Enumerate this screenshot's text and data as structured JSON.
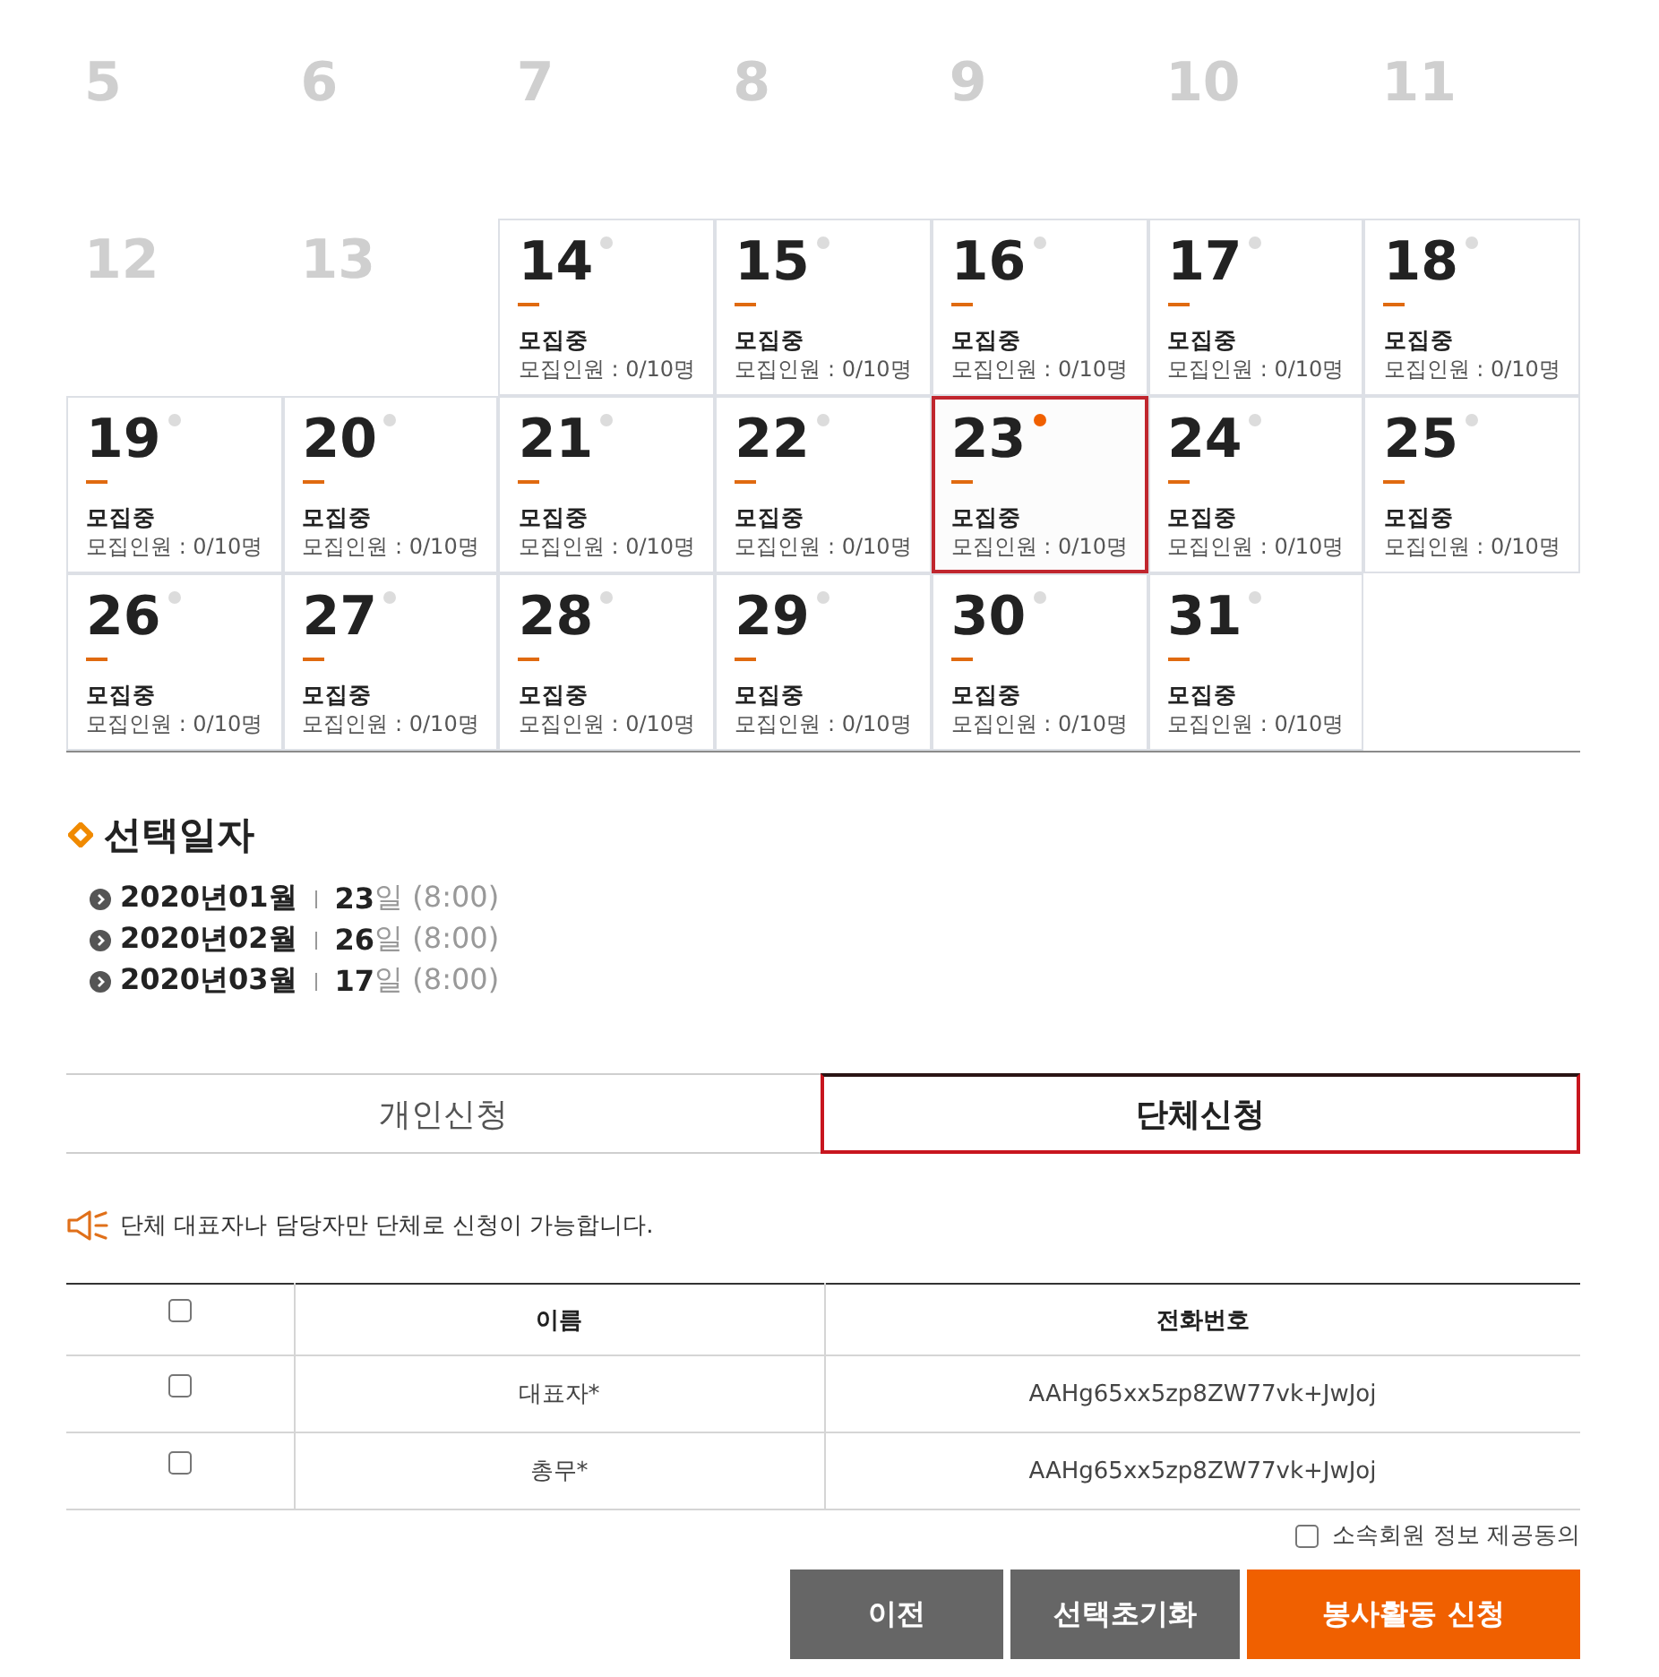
{
  "calendar": {
    "weeks": [
      [
        {
          "day": "5",
          "kind": "past"
        },
        {
          "day": "6",
          "kind": "past"
        },
        {
          "day": "7",
          "kind": "past"
        },
        {
          "day": "8",
          "kind": "past"
        },
        {
          "day": "9",
          "kind": "past"
        },
        {
          "day": "10",
          "kind": "past"
        },
        {
          "day": "11",
          "kind": "past"
        }
      ],
      [
        {
          "day": "12",
          "kind": "past"
        },
        {
          "day": "13",
          "kind": "past"
        },
        {
          "day": "14",
          "kind": "open",
          "status": "모집중",
          "capacity": "모집인원 : 0/10명",
          "selected": false
        },
        {
          "day": "15",
          "kind": "open",
          "status": "모집중",
          "capacity": "모집인원 : 0/10명",
          "selected": false
        },
        {
          "day": "16",
          "kind": "open",
          "status": "모집중",
          "capacity": "모집인원 : 0/10명",
          "selected": false
        },
        {
          "day": "17",
          "kind": "open",
          "status": "모집중",
          "capacity": "모집인원 : 0/10명",
          "selected": false
        },
        {
          "day": "18",
          "kind": "open",
          "status": "모집중",
          "capacity": "모집인원 : 0/10명",
          "selected": false
        }
      ],
      [
        {
          "day": "19",
          "kind": "open",
          "status": "모집중",
          "capacity": "모집인원 : 0/10명",
          "selected": false
        },
        {
          "day": "20",
          "kind": "open",
          "status": "모집중",
          "capacity": "모집인원 : 0/10명",
          "selected": false
        },
        {
          "day": "21",
          "kind": "open",
          "status": "모집중",
          "capacity": "모집인원 : 0/10명",
          "selected": false
        },
        {
          "day": "22",
          "kind": "open",
          "status": "모집중",
          "capacity": "모집인원 : 0/10명",
          "selected": false
        },
        {
          "day": "23",
          "kind": "open",
          "status": "모집중",
          "capacity": "모집인원 : 0/10명",
          "selected": true
        },
        {
          "day": "24",
          "kind": "open",
          "status": "모집중",
          "capacity": "모집인원 : 0/10명",
          "selected": false
        },
        {
          "day": "25",
          "kind": "open",
          "status": "모집중",
          "capacity": "모집인원 : 0/10명",
          "selected": false
        }
      ],
      [
        {
          "day": "26",
          "kind": "open",
          "status": "모집중",
          "capacity": "모집인원 : 0/10명",
          "selected": false
        },
        {
          "day": "27",
          "kind": "open",
          "status": "모집중",
          "capacity": "모집인원 : 0/10명",
          "selected": false
        },
        {
          "day": "28",
          "kind": "open",
          "status": "모집중",
          "capacity": "모집인원 : 0/10명",
          "selected": false
        },
        {
          "day": "29",
          "kind": "open",
          "status": "모집중",
          "capacity": "모집인원 : 0/10명",
          "selected": false
        },
        {
          "day": "30",
          "kind": "open",
          "status": "모집중",
          "capacity": "모집인원 : 0/10명",
          "selected": false
        },
        {
          "day": "31",
          "kind": "open",
          "status": "모집중",
          "capacity": "모집인원 : 0/10명",
          "selected": false
        }
      ]
    ]
  },
  "selected_dates": {
    "title": "선택일자",
    "items": [
      {
        "month": "2020년01월",
        "day": "23",
        "rest": "일 (8:00)"
      },
      {
        "month": "2020년02월",
        "day": "26",
        "rest": "일 (8:00)"
      },
      {
        "month": "2020년03월",
        "day": "17",
        "rest": "일 (8:00)"
      }
    ]
  },
  "tabs": [
    {
      "label": "개인신청",
      "selected": false
    },
    {
      "label": "단체신청",
      "selected": true
    }
  ],
  "notice": "단체 대표자나 담당자만 단체로 신청이 가능합니다.",
  "members_table": {
    "header_checked": false,
    "columns": [
      "이름",
      "전화번호"
    ],
    "rows": [
      {
        "checked": false,
        "name": "대표자*",
        "phone": "AAHg65xx5zp8ZW77vk+JwJoj"
      },
      {
        "checked": false,
        "name": "총무*",
        "phone": "AAHg65xx5zp8ZW77vk+JwJoj"
      }
    ]
  },
  "consent": {
    "label": "소속회원 정보 제공동의",
    "checked": false
  },
  "buttons": [
    {
      "label": "이전",
      "kind": "secondary"
    },
    {
      "label": "선택초기화",
      "kind": "secondary"
    },
    {
      "label": "봉사활동 신청",
      "kind": "primary"
    }
  ]
}
